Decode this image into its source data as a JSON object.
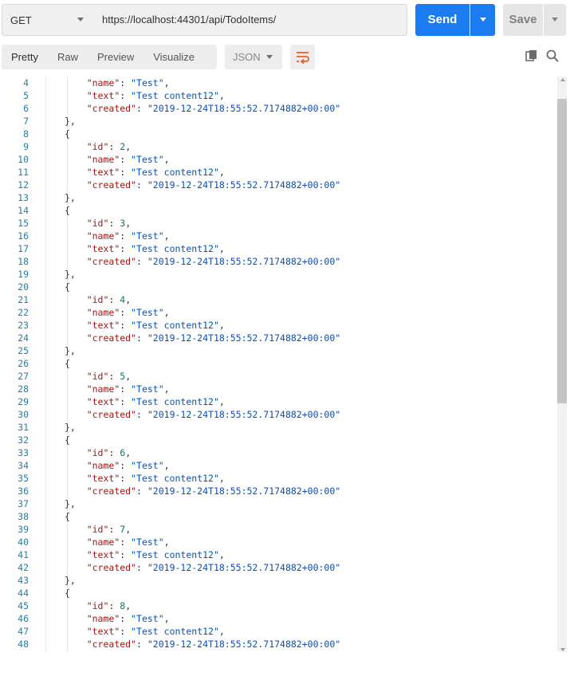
{
  "request": {
    "method": "GET",
    "url": "https://localhost:44301/api/TodoItems/",
    "send_label": "Send",
    "save_label": "Save"
  },
  "response_toolbar": {
    "tabs": [
      "Pretty",
      "Raw",
      "Preview",
      "Visualize"
    ],
    "active_tab": "Pretty",
    "format": "JSON"
  },
  "colors": {
    "send_button": "#1a7cf0",
    "wrap_icon": "#e8602c",
    "line_number": "#2a7d9a",
    "json_key": "#a31515",
    "json_string": "#0b4fb0",
    "json_number": "#0b7a5a"
  },
  "icons": {
    "method_dropdown": "chevron-down-icon",
    "wrap": "word-wrap-icon",
    "copy": "copy-icon",
    "search": "search-icon"
  },
  "editor": {
    "lines": [
      {
        "n": "4",
        "code": "        \"name\": \"Test\","
      },
      {
        "n": "5",
        "code": "        \"text\": \"Test content12\","
      },
      {
        "n": "6",
        "code": "        \"created\": \"2019-12-24T18:55:52.7174882+00:00\""
      },
      {
        "n": "7",
        "code": "    },"
      },
      {
        "n": "8",
        "code": "    {"
      },
      {
        "n": "9",
        "code": "        \"id\": 2,"
      },
      {
        "n": "10",
        "code": "        \"name\": \"Test\","
      },
      {
        "n": "11",
        "code": "        \"text\": \"Test content12\","
      },
      {
        "n": "12",
        "code": "        \"created\": \"2019-12-24T18:55:52.7174882+00:00\""
      },
      {
        "n": "13",
        "code": "    },"
      },
      {
        "n": "14",
        "code": "    {"
      },
      {
        "n": "15",
        "code": "        \"id\": 3,"
      },
      {
        "n": "16",
        "code": "        \"name\": \"Test\","
      },
      {
        "n": "17",
        "code": "        \"text\": \"Test content12\","
      },
      {
        "n": "18",
        "code": "        \"created\": \"2019-12-24T18:55:52.7174882+00:00\""
      },
      {
        "n": "19",
        "code": "    },"
      },
      {
        "n": "20",
        "code": "    {"
      },
      {
        "n": "21",
        "code": "        \"id\": 4,"
      },
      {
        "n": "22",
        "code": "        \"name\": \"Test\","
      },
      {
        "n": "23",
        "code": "        \"text\": \"Test content12\","
      },
      {
        "n": "24",
        "code": "        \"created\": \"2019-12-24T18:55:52.7174882+00:00\""
      },
      {
        "n": "25",
        "code": "    },"
      },
      {
        "n": "26",
        "code": "    {"
      },
      {
        "n": "27",
        "code": "        \"id\": 5,"
      },
      {
        "n": "28",
        "code": "        \"name\": \"Test\","
      },
      {
        "n": "29",
        "code": "        \"text\": \"Test content12\","
      },
      {
        "n": "30",
        "code": "        \"created\": \"2019-12-24T18:55:52.7174882+00:00\""
      },
      {
        "n": "31",
        "code": "    },"
      },
      {
        "n": "32",
        "code": "    {"
      },
      {
        "n": "33",
        "code": "        \"id\": 6,"
      },
      {
        "n": "34",
        "code": "        \"name\": \"Test\","
      },
      {
        "n": "35",
        "code": "        \"text\": \"Test content12\","
      },
      {
        "n": "36",
        "code": "        \"created\": \"2019-12-24T18:55:52.7174882+00:00\""
      },
      {
        "n": "37",
        "code": "    },"
      },
      {
        "n": "38",
        "code": "    {"
      },
      {
        "n": "39",
        "code": "        \"id\": 7,"
      },
      {
        "n": "40",
        "code": "        \"name\": \"Test\","
      },
      {
        "n": "41",
        "code": "        \"text\": \"Test content12\","
      },
      {
        "n": "42",
        "code": "        \"created\": \"2019-12-24T18:55:52.7174882+00:00\""
      },
      {
        "n": "43",
        "code": "    },"
      },
      {
        "n": "44",
        "code": "    {"
      },
      {
        "n": "45",
        "code": "        \"id\": 8,"
      },
      {
        "n": "46",
        "code": "        \"name\": \"Test\","
      },
      {
        "n": "47",
        "code": "        \"text\": \"Test content12\","
      },
      {
        "n": "48",
        "code": "        \"created\": \"2019-12-24T18:55:52.7174882+00:00\""
      }
    ]
  }
}
